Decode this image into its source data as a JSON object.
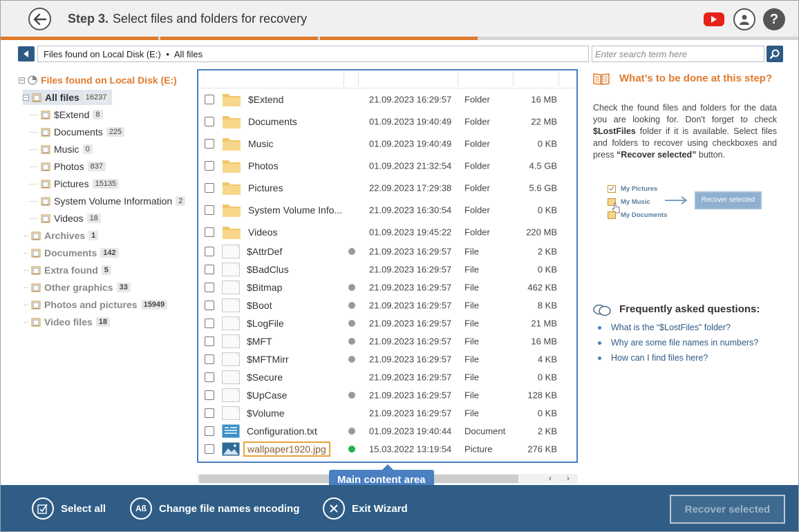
{
  "header": {
    "step_label": "Step 3.",
    "title": "Select files and folders for recovery"
  },
  "colors": {
    "accent": "#e07a2d",
    "brand": "#2f5d86",
    "highlight": "#4a7fc1",
    "status_grey": "#999999",
    "status_green": "#22b14c"
  },
  "path": {
    "location": "Files found on Local Disk (E:)",
    "separator": "•",
    "current": "All files"
  },
  "search": {
    "placeholder": "Enter search term here"
  },
  "tree": {
    "root": "Files found on Local Disk (E:)",
    "all_files": {
      "label": "All files",
      "count": "16237"
    },
    "children": [
      {
        "label": "$Extend",
        "count": "8"
      },
      {
        "label": "Documents",
        "count": "225"
      },
      {
        "label": "Music",
        "count": "0"
      },
      {
        "label": "Photos",
        "count": "837"
      },
      {
        "label": "Pictures",
        "count": "15135"
      },
      {
        "label": "System Volume Information",
        "count": "2"
      },
      {
        "label": "Videos",
        "count": "18"
      }
    ],
    "categories": [
      {
        "label": "Archives",
        "count": "1"
      },
      {
        "label": "Documents",
        "count": "142"
      },
      {
        "label": "Extra found",
        "count": "5"
      },
      {
        "label": "Other graphics",
        "count": "33"
      },
      {
        "label": "Photos and pictures",
        "count": "15949"
      },
      {
        "label": "Video files",
        "count": "18"
      }
    ]
  },
  "files": [
    {
      "name": "$Extend",
      "date": "21.09.2023 16:29:57",
      "type": "Folder",
      "size": "16 MB",
      "kind": "folder",
      "status": ""
    },
    {
      "name": "Documents",
      "date": "01.09.2023 19:40:49",
      "type": "Folder",
      "size": "22 MB",
      "kind": "folder",
      "status": ""
    },
    {
      "name": "Music",
      "date": "01.09.2023 19:40:49",
      "type": "Folder",
      "size": "0 KB",
      "kind": "folder",
      "status": ""
    },
    {
      "name": "Photos",
      "date": "01.09.2023 21:32:54",
      "type": "Folder",
      "size": "4.5 GB",
      "kind": "folder",
      "status": ""
    },
    {
      "name": "Pictures",
      "date": "22.09.2023 17:29:38",
      "type": "Folder",
      "size": "5.6 GB",
      "kind": "folder",
      "status": ""
    },
    {
      "name": "System Volume Info...",
      "date": "21.09.2023 16:30:54",
      "type": "Folder",
      "size": "0 KB",
      "kind": "folder",
      "status": ""
    },
    {
      "name": "Videos",
      "date": "01.09.2023 19:45:22",
      "type": "Folder",
      "size": "220 MB",
      "kind": "folder",
      "status": ""
    },
    {
      "name": "$AttrDef",
      "date": "21.09.2023 16:29:57",
      "type": "File",
      "size": "2 KB",
      "kind": "file",
      "status": "grey"
    },
    {
      "name": "$BadClus",
      "date": "21.09.2023 16:29:57",
      "type": "File",
      "size": "0 KB",
      "kind": "file",
      "status": ""
    },
    {
      "name": "$Bitmap",
      "date": "21.09.2023 16:29:57",
      "type": "File",
      "size": "462 KB",
      "kind": "file",
      "status": "grey"
    },
    {
      "name": "$Boot",
      "date": "21.09.2023 16:29:57",
      "type": "File",
      "size": "8 KB",
      "kind": "file",
      "status": "grey"
    },
    {
      "name": "$LogFile",
      "date": "21.09.2023 16:29:57",
      "type": "File",
      "size": "21 MB",
      "kind": "file",
      "status": "grey"
    },
    {
      "name": "$MFT",
      "date": "21.09.2023 16:29:57",
      "type": "File",
      "size": "16 MB",
      "kind": "file",
      "status": "grey"
    },
    {
      "name": "$MFTMirr",
      "date": "21.09.2023 16:29:57",
      "type": "File",
      "size": "4 KB",
      "kind": "file",
      "status": "grey"
    },
    {
      "name": "$Secure",
      "date": "21.09.2023 16:29:57",
      "type": "File",
      "size": "0 KB",
      "kind": "file",
      "status": ""
    },
    {
      "name": "$UpCase",
      "date": "21.09.2023 16:29:57",
      "type": "File",
      "size": "128 KB",
      "kind": "file",
      "status": "grey"
    },
    {
      "name": "$Volume",
      "date": "21.09.2023 16:29:57",
      "type": "File",
      "size": "0 KB",
      "kind": "file",
      "status": ""
    },
    {
      "name": "Configuration.txt",
      "date": "01.09.2023 19:40:44",
      "type": "Document",
      "size": "2 KB",
      "kind": "doc",
      "status": "grey"
    },
    {
      "name": "wallpaper1920.jpg",
      "date": "15.03.2022 13:19:54",
      "type": "Picture",
      "size": "276 KB",
      "kind": "picture",
      "status": "green",
      "highlight": true
    }
  ],
  "callout": "Main content area",
  "help": {
    "title": "What’s to be done at this step?",
    "text_1": "Check the found files and folders for the data you are looking for. Don't forget to check ",
    "text_bold_1": "$LostFiles",
    "text_2": " folder if it is available. Select files and folders to recover using checkboxes and press ",
    "text_bold_2": "“Recover selected”",
    "text_3": " button.",
    "illustration": {
      "item_1": "My Pictures",
      "item_2": "My Music",
      "item_3": "My Documents",
      "button": "Recover selected"
    }
  },
  "faq": {
    "title": "Frequently asked questions:",
    "items": [
      "What is the “$LostFiles” folder?",
      "Why are some file names in numbers?",
      "How can I find files here?"
    ]
  },
  "footer": {
    "select_all": "Select all",
    "encoding": "Change file names encoding",
    "exit": "Exit Wizard",
    "recover": "Recover selected"
  }
}
